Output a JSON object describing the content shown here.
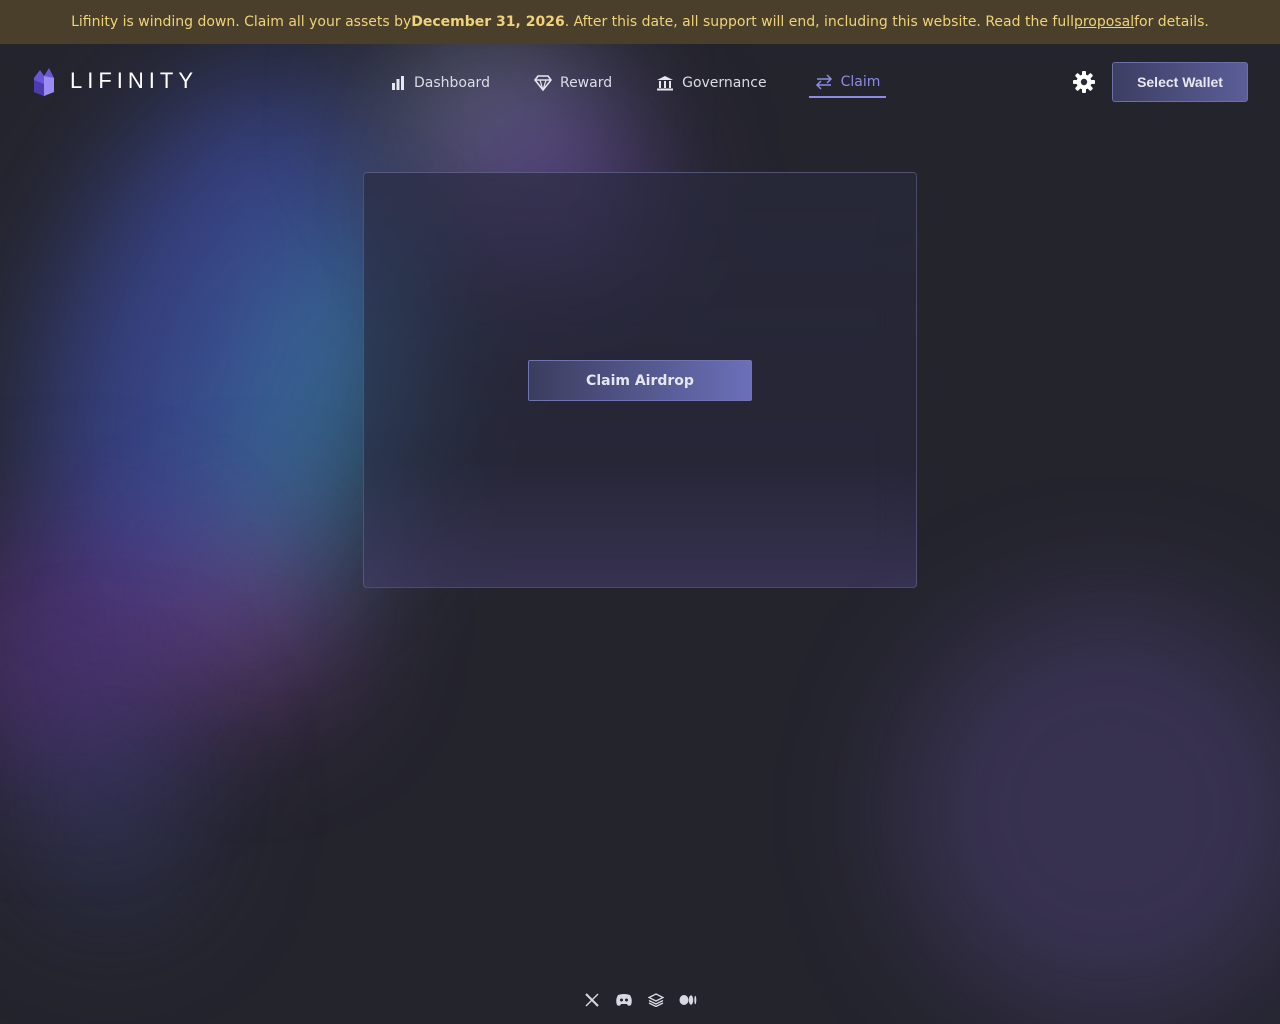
{
  "banner": {
    "text_before": "Lifinity is winding down. Claim all your assets by ",
    "date": "December 31, 2026",
    "text_middle": ". After this date, all support will end, including this website. Read the full ",
    "link": "proposal",
    "text_after": " for details."
  },
  "header": {
    "logo_text": "LIFINITY",
    "nav": [
      {
        "label": "Dashboard",
        "icon": "bar-chart-icon"
      },
      {
        "label": "Reward",
        "icon": "diamond-icon"
      },
      {
        "label": "Governance",
        "icon": "bank-icon"
      },
      {
        "label": "Claim",
        "icon": "swap-arrows-icon",
        "active": true
      }
    ],
    "settings_icon": "gear-icon",
    "wallet_label": "Select Wallet"
  },
  "main": {
    "claim_button": "Claim Airdrop"
  },
  "footer": {
    "socials": [
      "x-icon",
      "discord-icon",
      "gitbook-icon",
      "medium-icon"
    ]
  },
  "colors": {
    "banner_bg": "#4a3f2a",
    "banner_text": "#f0d27a",
    "accent": "#8c8ce6",
    "page_bg": "#24242d"
  }
}
